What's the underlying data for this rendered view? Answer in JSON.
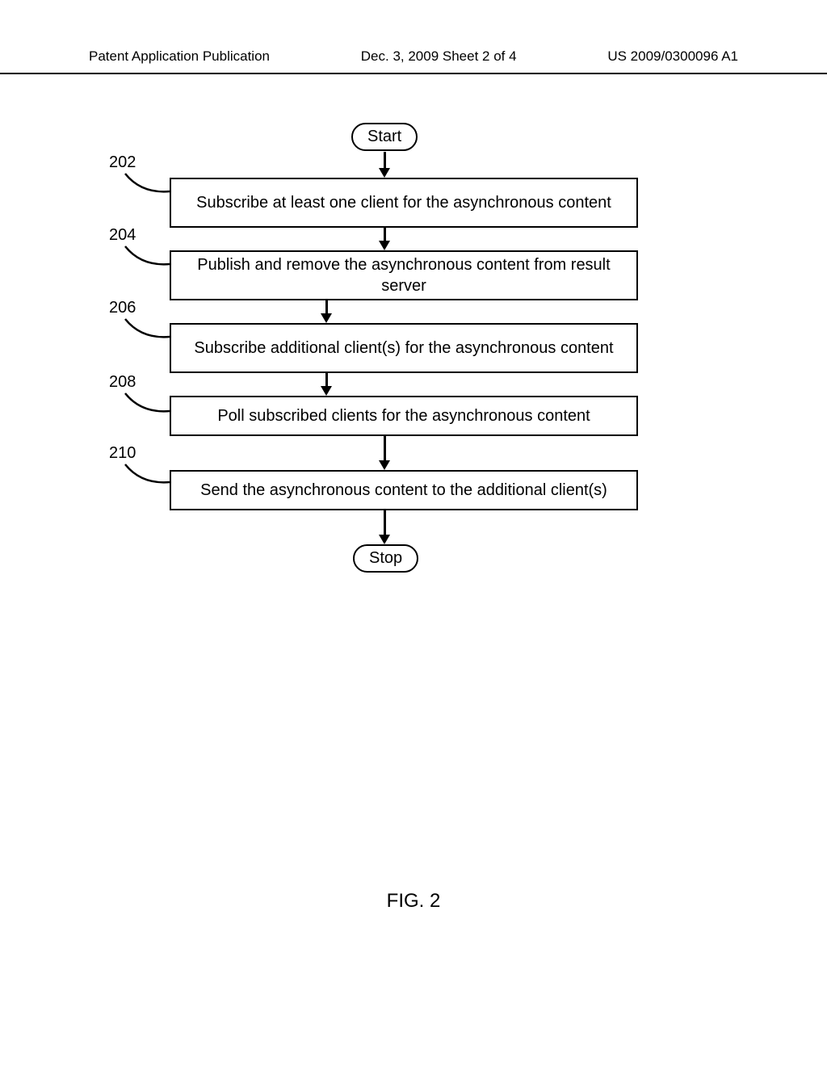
{
  "header": {
    "left": "Patent Application Publication",
    "center": "Dec. 3, 2009  Sheet 2 of 4",
    "right": "US 2009/0300096 A1"
  },
  "terminators": {
    "start": "Start",
    "stop": "Stop"
  },
  "refs": {
    "r202": "202",
    "r204": "204",
    "r206": "206",
    "r208": "208",
    "r210": "210"
  },
  "steps": {
    "s202": "Subscribe at least one client for the asynchronous content",
    "s204": "Publish and remove the asynchronous content from result server",
    "s206": "Subscribe additional client(s) for the asynchronous content",
    "s208": "Poll subscribed clients for the asynchronous content",
    "s210": "Send the asynchronous content to the additional client(s)"
  },
  "figure": "FIG. 2",
  "chart_data": {
    "type": "flowchart",
    "title": "FIG. 2",
    "nodes": [
      {
        "id": "start",
        "type": "terminator",
        "label": "Start"
      },
      {
        "id": "202",
        "type": "process",
        "ref": "202",
        "label": "Subscribe at least one client for the asynchronous content"
      },
      {
        "id": "204",
        "type": "process",
        "ref": "204",
        "label": "Publish and remove the asynchronous content from result server"
      },
      {
        "id": "206",
        "type": "process",
        "ref": "206",
        "label": "Subscribe additional client(s) for the asynchronous content"
      },
      {
        "id": "208",
        "type": "process",
        "ref": "208",
        "label": "Poll subscribed clients for the asynchronous content"
      },
      {
        "id": "210",
        "type": "process",
        "ref": "210",
        "label": "Send the asynchronous content to the additional client(s)"
      },
      {
        "id": "stop",
        "type": "terminator",
        "label": "Stop"
      }
    ],
    "edges": [
      {
        "from": "start",
        "to": "202"
      },
      {
        "from": "202",
        "to": "204"
      },
      {
        "from": "204",
        "to": "206"
      },
      {
        "from": "206",
        "to": "208"
      },
      {
        "from": "208",
        "to": "210"
      },
      {
        "from": "210",
        "to": "stop"
      }
    ]
  }
}
